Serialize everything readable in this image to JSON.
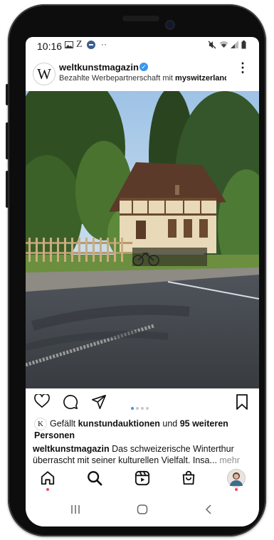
{
  "status_bar": {
    "time": "10:16",
    "left_icons": [
      "gallery-icon",
      "z-icon",
      "news-icon",
      "more-icon"
    ],
    "right_icons": [
      "mute-icon",
      "wifi-icon",
      "signal-icon",
      "battery-icon"
    ]
  },
  "post": {
    "avatar_letter": "W",
    "username": "weltkunstmagazin",
    "sponsor_prefix": "Bezahlte Werbepartnerschaft mit ",
    "sponsor_partner": "myswitzerland",
    "photo_alt": "Half-timbered house beside a road with trees and a fence",
    "carousel": {
      "count": 4,
      "active_index": 0
    },
    "likes": {
      "avatar_letter": "K",
      "prefix": "Gefällt ",
      "user": "kunstundauktionen",
      "middle": " und ",
      "others": "95 weiteren Personen"
    },
    "caption": {
      "username": "weltkunstmagazin",
      "text": " Das schweizerische Winterthur überrascht mit seiner kulturellen Vielfalt. Insa...",
      "more": " mehr"
    }
  },
  "tabs": [
    "home-icon",
    "search-icon",
    "reels-icon",
    "shop-icon",
    "profile-avatar"
  ],
  "nav_buttons": [
    "recent-apps-icon",
    "home-nav-icon",
    "back-icon"
  ],
  "colors": {
    "accent": "#3897f0",
    "notification": "#ed4956",
    "text": "#111111",
    "muted": "#8e8e8e"
  }
}
